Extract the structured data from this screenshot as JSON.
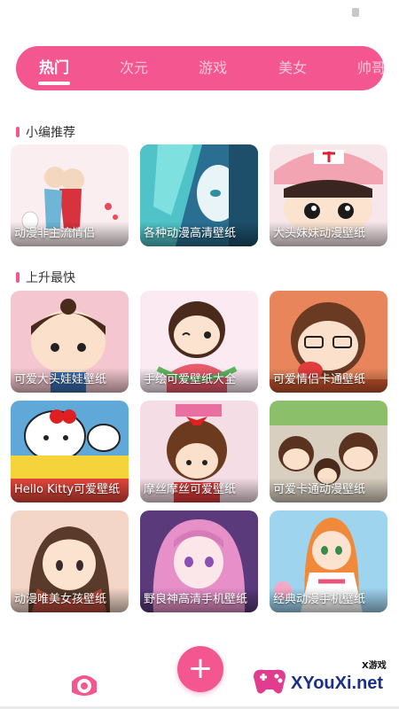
{
  "tabs": [
    {
      "label": "热门",
      "active": true
    },
    {
      "label": "次元",
      "active": false
    },
    {
      "label": "游戏",
      "active": false
    },
    {
      "label": "美女",
      "active": false
    },
    {
      "label": "帅哥",
      "active": false
    }
  ],
  "sections": {
    "recommended": {
      "title": "小编推荐",
      "cards": [
        "动漫非主流情侣",
        "各种动漫高清壁纸",
        "大头妹妹动漫壁纸"
      ]
    },
    "rising": {
      "title": "上升最快",
      "cards": [
        "可爱大头娃娃壁纸",
        "手绘可爱壁纸大全",
        "可爱情侣卡通壁纸",
        "Hello Kitty可爱壁纸",
        "摩丝摩丝可爱壁纸",
        "可爱卡通动漫壁纸",
        "动漫唯美女孩壁纸",
        "野良神高清手机壁纸",
        "经典动漫手机壁纸"
      ]
    }
  },
  "fab": {
    "icon": "plus-icon",
    "label": "+"
  },
  "bottom_nav": {
    "icon": "eye-icon"
  },
  "watermark": {
    "small": "X游戏",
    "big": "XYouXi.net"
  },
  "colors": {
    "accent": "#f4578f",
    "tab_inactive": "#fbc6d8"
  }
}
